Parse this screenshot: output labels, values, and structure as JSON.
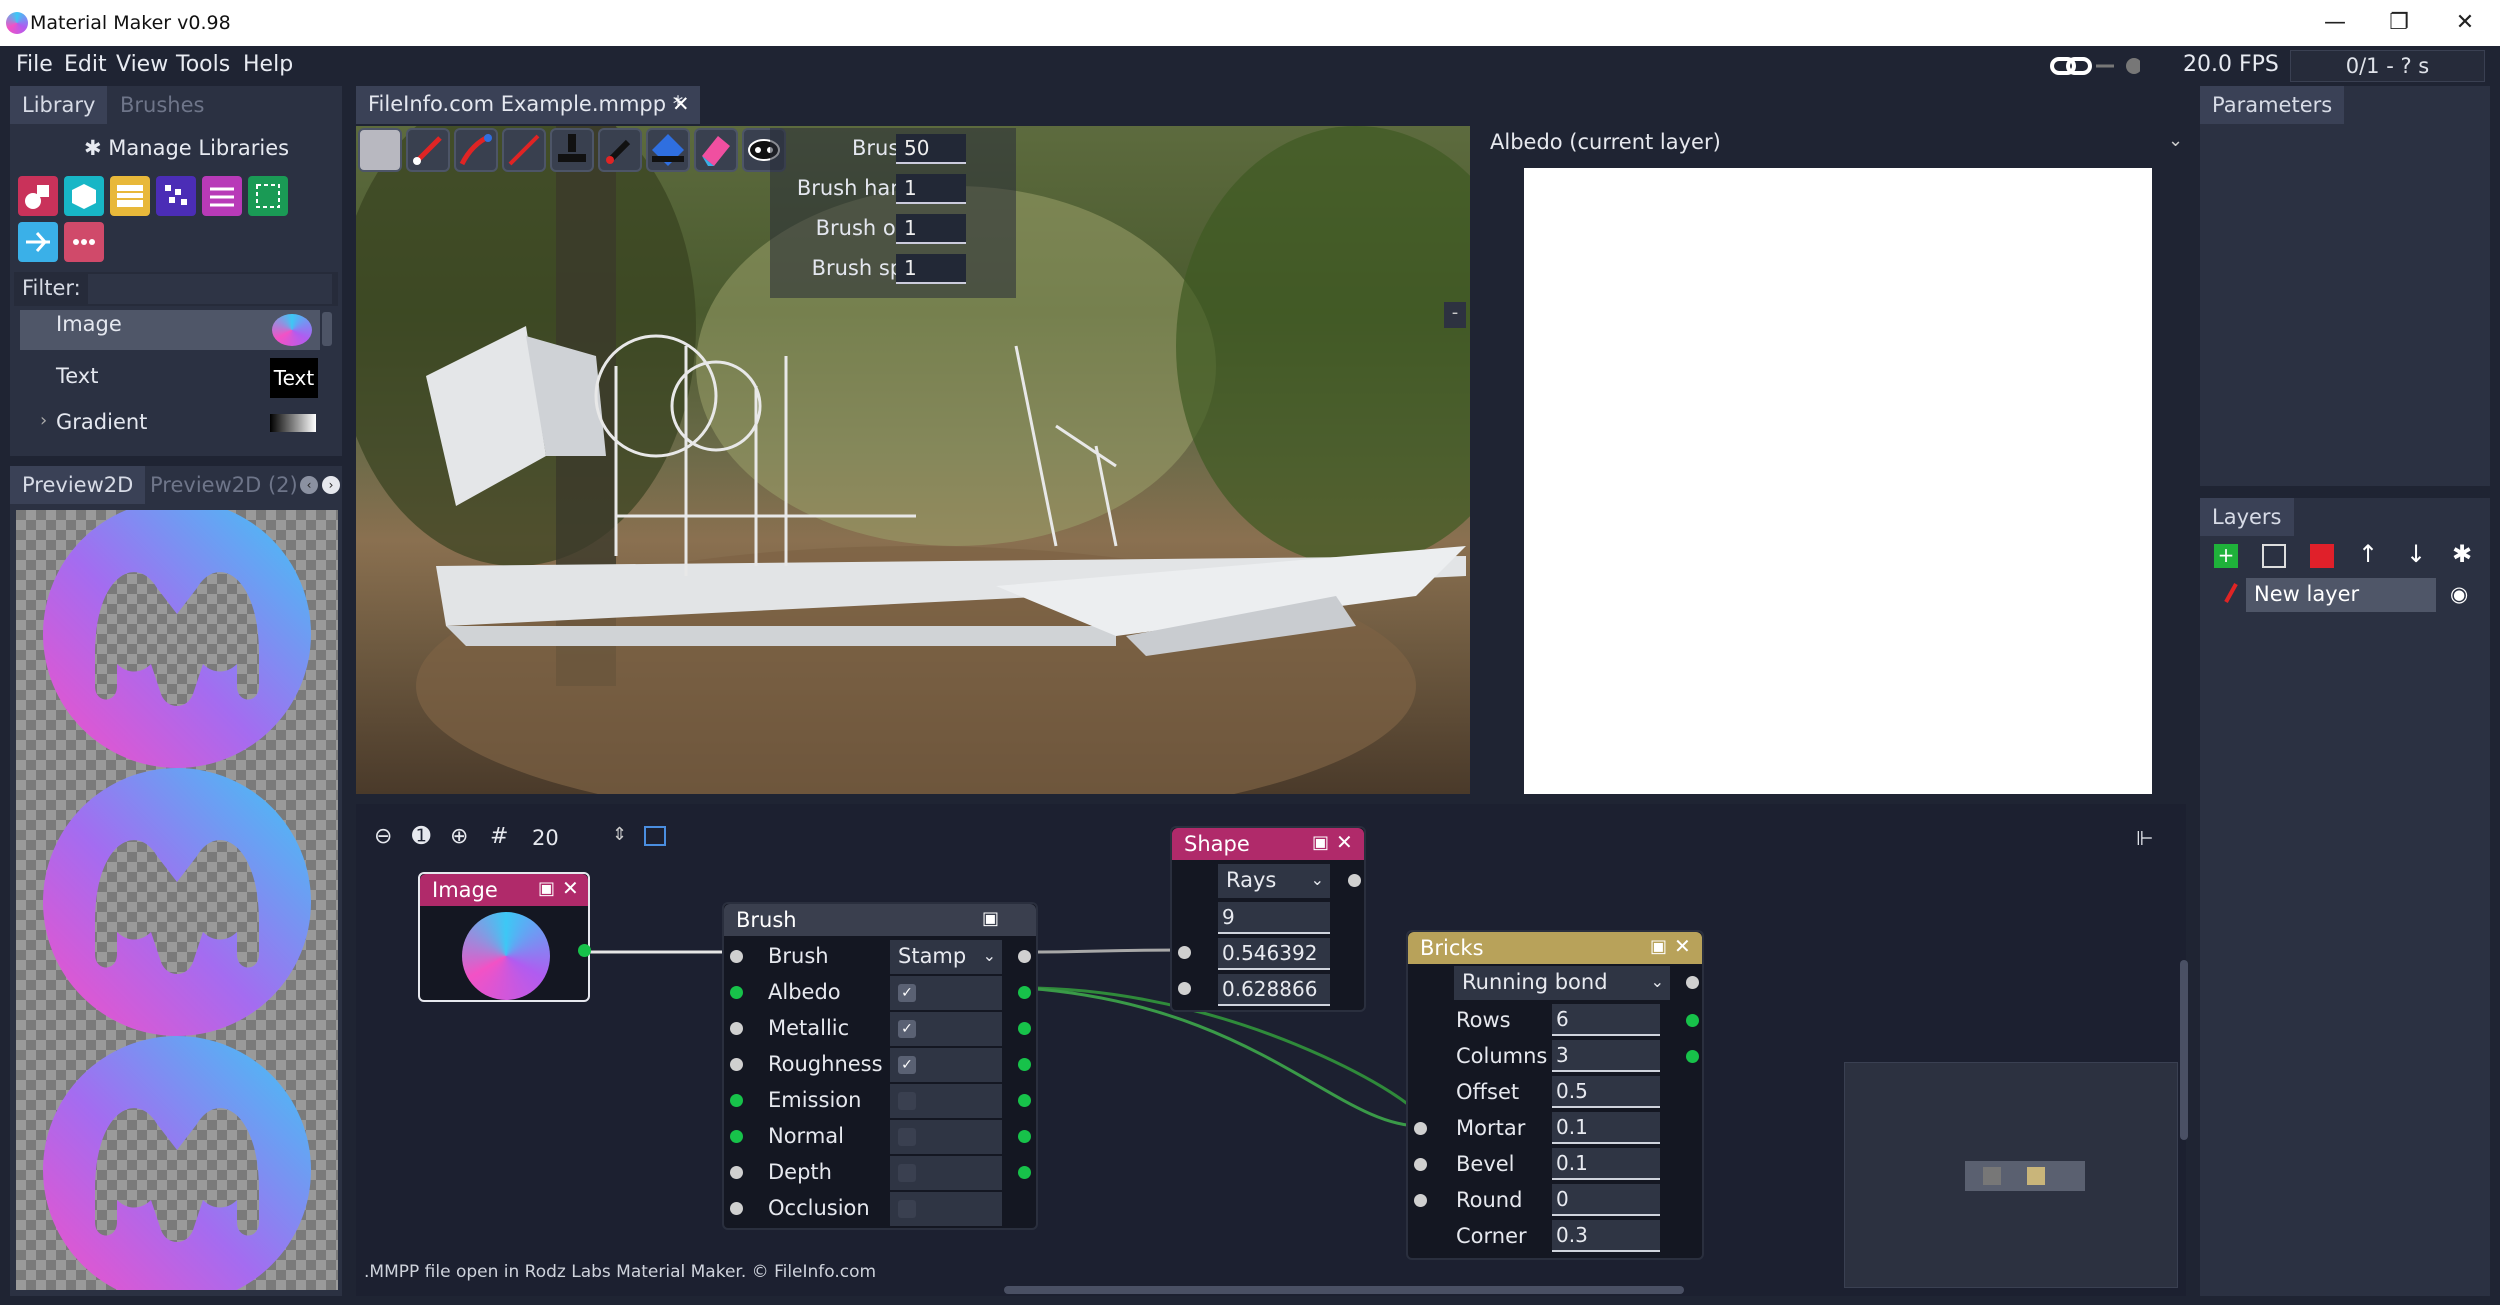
{
  "window": {
    "title": "Material Maker v0.98",
    "minimize": "—",
    "maximize": "❐",
    "close": "✕"
  },
  "menu": {
    "file": "File",
    "edit": "Edit",
    "view": "View",
    "tools": "Tools",
    "help": "Help"
  },
  "status": {
    "fps": "20.0 FPS",
    "render": "0/1 - ? s"
  },
  "library": {
    "tab_library": "Library",
    "tab_brushes": "Brushes",
    "manage": "Manage Libraries",
    "filter_label": "Filter:",
    "items": [
      {
        "label": "Image",
        "preview": ""
      },
      {
        "label": "Text",
        "preview": "Text"
      },
      {
        "label": "Gradient",
        "preview": ""
      }
    ]
  },
  "preview": {
    "tab1": "Preview2D",
    "tab2": "Preview2D (2)"
  },
  "doc": {
    "tab": "FileInfo.com Example.mmpp *",
    "close": "✕"
  },
  "brush_params": [
    {
      "label": "Brush size",
      "value": "50"
    },
    {
      "label": "Brush hardness",
      "value": "1"
    },
    {
      "label": "Brush opacity",
      "value": "1"
    },
    {
      "label": "Brush spacing",
      "value": "1"
    }
  ],
  "albedo": {
    "label": "Albedo (current layer)"
  },
  "parameters": {
    "tab": "Parameters"
  },
  "layers": {
    "tab": "Layers",
    "items": [
      {
        "name": "New layer"
      }
    ]
  },
  "graph": {
    "zoom": "20",
    "footer": ".MMPP file open in Rodz Labs Material Maker. © FileInfo.com",
    "image_node": {
      "title": "Image"
    },
    "brush_node": {
      "title": "Brush",
      "rows": [
        {
          "label": "Brush",
          "type": "drop",
          "value": "Stamp"
        },
        {
          "label": "Albedo",
          "checked": true
        },
        {
          "label": "Metallic",
          "checked": true
        },
        {
          "label": "Roughness",
          "checked": true
        },
        {
          "label": "Emission",
          "checked": false
        },
        {
          "label": "Normal",
          "checked": false
        },
        {
          "label": "Depth",
          "checked": false
        },
        {
          "label": "Occlusion",
          "checked": false
        }
      ]
    },
    "shape_node": {
      "title": "Shape",
      "mode": "Rays",
      "values": [
        "9",
        "0.546392",
        "0.628866"
      ]
    },
    "bricks_node": {
      "title": "Bricks",
      "mode": "Running bond",
      "rows": [
        {
          "label": "Rows",
          "value": "6"
        },
        {
          "label": "Columns",
          "value": "3"
        },
        {
          "label": "Offset",
          "value": "0.5"
        },
        {
          "label": "Mortar",
          "value": "0.1"
        },
        {
          "label": "Bevel",
          "value": "0.1"
        },
        {
          "label": "Round",
          "value": "0"
        },
        {
          "label": "Corner",
          "value": "0.3"
        }
      ]
    }
  }
}
